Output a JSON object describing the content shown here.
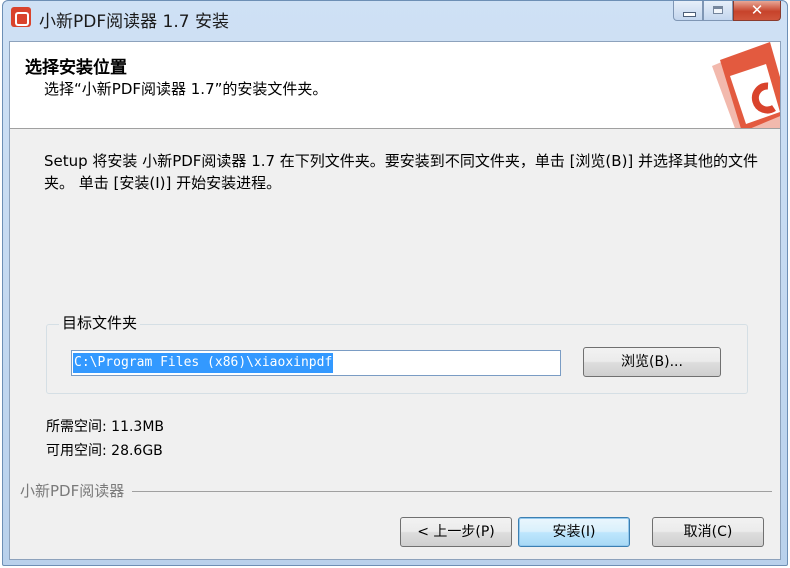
{
  "window": {
    "title": "小新PDF阅读器 1.7 安装",
    "close_symbol": "✕"
  },
  "header": {
    "title": "选择安装位置",
    "subtitle": "选择“小新PDF阅读器 1.7”的安装文件夹。",
    "logo_icon": "xiaoxin-pdf-logo"
  },
  "intro": {
    "text": "Setup 将安装 小新PDF阅读器 1.7 在下列文件夹。要安装到不同文件夹，单击 [浏览(B)] 并选择其他的文件夹。 单击 [安装(I)] 开始安装进程。"
  },
  "destination": {
    "group_label": "目标文件夹",
    "path": "C:\\Program Files (x86)\\xiaoxinpdf",
    "browse_label": "浏览(B)..."
  },
  "space": {
    "required": "所需空间: 11.3MB",
    "available": "可用空间: 28.6GB"
  },
  "footer": {
    "brand": "小新PDF阅读器",
    "back_label": "< 上一步(P)",
    "install_label": "安装(I)",
    "cancel_label": "取消(C)"
  },
  "colors": {
    "accent": "#d9432c",
    "selection": "#3399ff"
  }
}
